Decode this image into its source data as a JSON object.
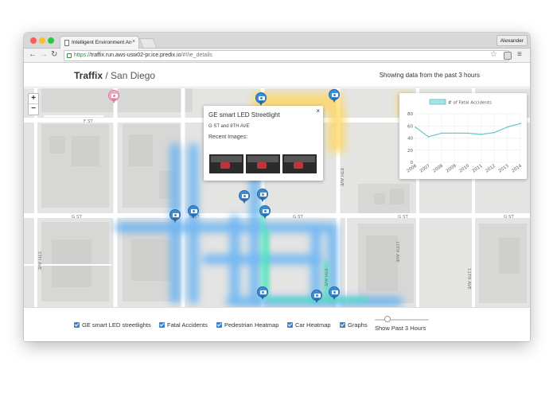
{
  "browser": {
    "tab_title": "Intelligent Environment An",
    "profile_name": "Alexander",
    "url_scheme": "https://",
    "url_host": "traffix.run.aws-usw02-pr.ice.predix.io",
    "url_path": "/#!/ie_details"
  },
  "header": {
    "brand": "Traffix",
    "separator": "/",
    "city": "San Diego",
    "status": "Showing data from the past 3 hours"
  },
  "map": {
    "zoom_in": "+",
    "zoom_out": "−",
    "street_labels": [
      "F ST",
      "G ST",
      "G ST",
      "G ST",
      "G ST",
      "8TH AVE",
      "10TH AVE",
      "9TH AVE",
      "11TH AVE",
      "5TH AVE"
    ]
  },
  "popup": {
    "close": "×",
    "title": "GE smart LED Streetlight",
    "address": "G ST and 8TH AVE",
    "images_label": "Recent Images:"
  },
  "chart_data": {
    "type": "line",
    "title": "",
    "legend": [
      "# of Fatal Accidents"
    ],
    "legend_position": "top",
    "xlabel": "",
    "ylabel": "",
    "ylim": [
      0,
      80
    ],
    "yticks": [
      0,
      20,
      40,
      60,
      80
    ],
    "grid": true,
    "categories": [
      "2006",
      "2007",
      "2008",
      "2009",
      "2010",
      "2011",
      "2012",
      "2013",
      "2014"
    ],
    "series": [
      {
        "name": "# of Fatal Accidents",
        "values": [
          58,
          42,
          48,
          48,
          48,
          46,
          49,
          58,
          64
        ]
      }
    ],
    "colors": {
      "line": "#6cc9cf",
      "legend_fill": "#a8e3e6"
    }
  },
  "controls": {
    "streetlights": "GE smart LED streetlights",
    "fatal": "Fatal Accidents",
    "pedestrian": "Pedestrian Heatmap",
    "car": "Car Heatmap",
    "graphs": "Graphs",
    "slider_label": "Show Past 3 Hours",
    "slider_value_hours": 3
  },
  "colors": {
    "accent": "#3f8bd1",
    "heat_pedestrian": "#5fb0f5",
    "heat_car": "#ffd55a"
  }
}
